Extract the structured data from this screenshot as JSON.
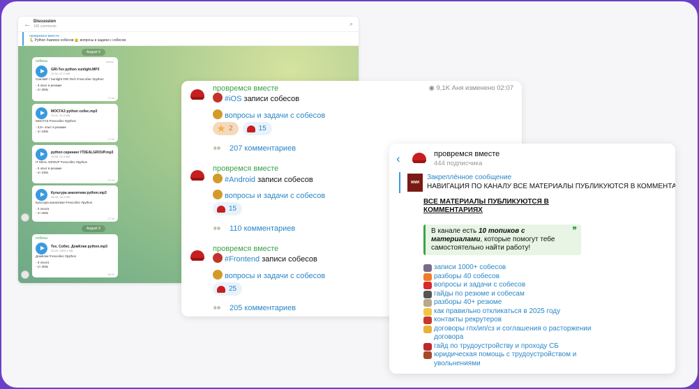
{
  "discussion": {
    "title": "Discussion",
    "subtitle": "100 comments",
    "pinned_title": "провремся вместе",
    "pinned_text": "🐍 Python #записи собесов  👷 вопросы и задачи с собесов",
    "date1": "August 9",
    "date2": "August 9",
    "messages": [
      {
        "author": "собесы",
        "admin": "admin",
        "file": "GRI-Тех python sunlight.MP3",
        "meta": "10:34, 47.2 MB",
        "lines": [
          "Санлайт / Sunlight GRI Tech #техсобес #python",
          "",
          "- 3 опыт в резюме",
          "- от 250к"
        ],
        "time": "17:33"
      },
      {
        "author": "",
        "admin": "",
        "file": "МОСГАЗ python собес.mp3",
        "meta": "23:01, 26.3 MB",
        "lines": [
          "МОСГАЗ #техсобес #python",
          "",
          "- 3,5+ опыт в резюме",
          "- от 230к"
        ],
        "time": "17:33"
      },
      {
        "author": "",
        "admin": "",
        "file": "python скрининг ITDEALGROUP.mp3",
        "meta": "15:58, 22.4 MB",
        "lines": [
          "IT DEAL GROUP #техсобес #python",
          "",
          "- 3 опыт в резюме",
          "- от 230к"
        ],
        "time": "17:33"
      },
      {
        "author": "",
        "admin": "",
        "file": "Культура аналитики python.mp3",
        "meta": "28:28, 26.4 MB",
        "lines": [
          "Культура аналитики #техсобес #python",
          "",
          "- 2 опыта",
          "- от 200к"
        ],
        "time": "17:33"
      },
      {
        "author": "собесы",
        "admin": "",
        "file": "Тех. Собес. ДомКлик python.mp3",
        "meta": "25:26, 2890.4 MB",
        "lines": [
          "ДомКлик #техсобес #python",
          "",
          "- 3 опыта",
          "- от 300к"
        ],
        "time": "18:03"
      }
    ]
  },
  "channel_posts": {
    "posts": [
      {
        "author": "провремся вместе",
        "meta": "9,1K Аня изменено 02:07",
        "tag": "#iOS",
        "title": " записи собесов",
        "link": "вопросы и задачи с собесов",
        "reactions": [
          {
            "count": "2",
            "kind": "star"
          },
          {
            "count": "15",
            "kind": "hat"
          }
        ],
        "comments": "207 комментариев"
      },
      {
        "author": "провремся вместе",
        "meta": "",
        "tag": "#Android",
        "title": " записи собесов",
        "link": "вопросы и задачи с собесов",
        "reactions": [
          {
            "count": "15",
            "kind": "hat"
          }
        ],
        "comments": "110 комментариев"
      },
      {
        "author": "провремся вместе",
        "meta": "",
        "tag": "#Frontend",
        "title": " записи собесов",
        "link": "вопросы и задачи с собесов",
        "reactions": [
          {
            "count": "25",
            "kind": "hat"
          }
        ],
        "comments": "205 комментариев"
      }
    ]
  },
  "channel_info": {
    "back_icon": "chevron-left-icon",
    "name": "провремся вместе",
    "subscribers": "444 подписчика",
    "pin_thumb": "ЖМИ",
    "pin_title": "Закреплённое сообщение",
    "pin_text": "НАВИГАЦИЯ ПО КАНАЛУ  ВСЕ МАТЕРИАЛЫ ПУБЛИКУЮТСЯ В КОММЕНТА",
    "heading": "ВСЕ МАТЕРИАЛЫ ПУБЛИКУЮТСЯ В КОММЕНТАРИЯХ",
    "quote_pre": "В канале есть ",
    "quote_bold": "10 топиков с материалами",
    "quote_post": ", которые помогут тебе самостоятельно найти работу!",
    "quote_mark": "❞",
    "items": [
      {
        "text": "записи 1000+ собесов",
        "color": "#7a6a8a"
      },
      {
        "text": "разборы 40 собесов",
        "color": "#f07a28"
      },
      {
        "text": "вопросы и задачи с собесов",
        "color": "#d82a2a"
      },
      {
        "text": "гайды по резюме и собесам",
        "color": "#555555"
      },
      {
        "text": "разборы 40+ резюме",
        "color": "#b9a88a"
      },
      {
        "text": "как правильно откликаться в 2025 году",
        "color": "#f3c542"
      },
      {
        "text": "контакты рекрутеров",
        "color": "#c63a2a"
      },
      {
        "text": "договоры гпх/ип/сз и соглашения о расторжении договора",
        "color": "#e8b23a"
      },
      {
        "text": "гайд по трудоустройству и проходу СБ",
        "color": "#c0282a"
      },
      {
        "text": "юридическая помощь с трудоустройством и увольнениями",
        "color": "#a34a2a"
      }
    ]
  }
}
